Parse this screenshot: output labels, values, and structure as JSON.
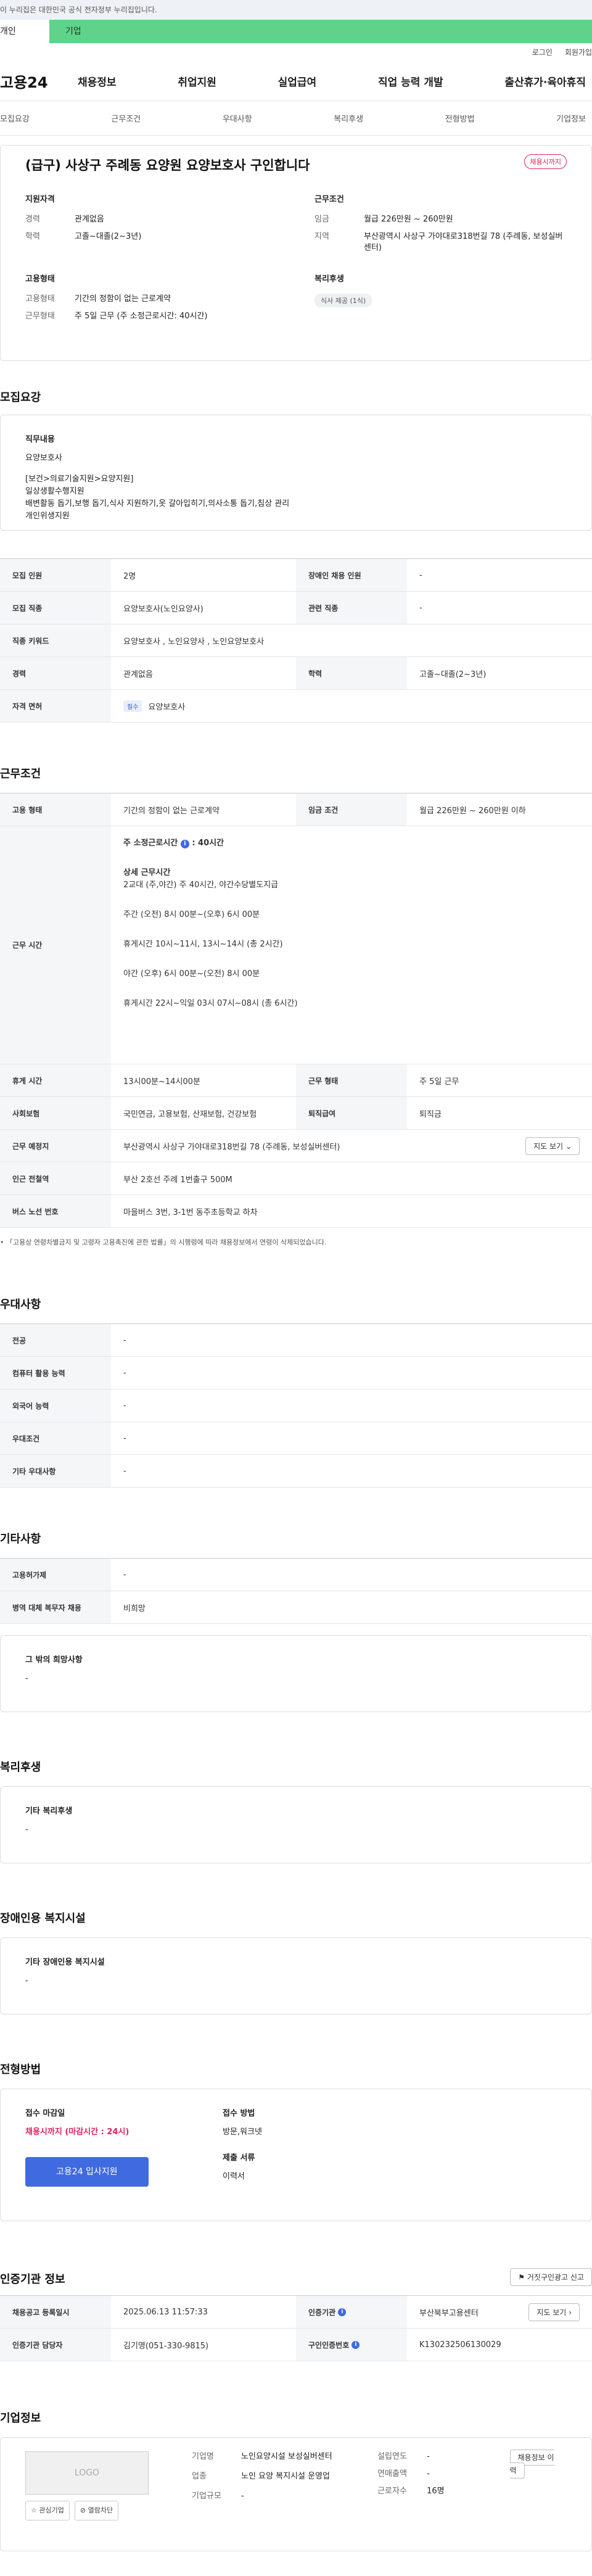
{
  "gov_banner": "이 누리집은 대한민국 공식 전자정부 누리집입니다.",
  "tabs": {
    "person": "개인",
    "company": "기업"
  },
  "util": {
    "login": "로그인",
    "signup": "회원가입"
  },
  "logo": "고용24",
  "gnb": [
    "채용정보",
    "취업지원",
    "실업급여",
    "직업 능력 개발",
    "출산휴가·육아휴직"
  ],
  "lnb": [
    "모집요강",
    "근무조건",
    "우대사항",
    "복리후생",
    "전형방법",
    "기업정보"
  ],
  "summary": {
    "title": "(급구) 사상구 주례동 요양원 요양보호사 구인합니다",
    "badge": "채용시까지",
    "qual_title": "지원자격",
    "qual": [
      {
        "k": "경력",
        "v": "관계없음"
      },
      {
        "k": "학력",
        "v": "고졸~대졸(2~3년)"
      }
    ],
    "emp_title": "고용형태",
    "emp": [
      {
        "k": "고용형태",
        "v": "기간의 정함이 없는 근로계약"
      },
      {
        "k": "근무형태",
        "v": "주 5일 근무 (주 소정근로시간: 40시간)"
      }
    ],
    "cond_title": "근무조건",
    "cond": [
      {
        "k": "임금",
        "v": "월급 226만원 ~ 260만원"
      },
      {
        "k": "지역",
        "v": "부산광역시 사상구 가야대로318번길 78 (주례동, 보성실버센터)"
      }
    ],
    "welfare_title": "복리후생",
    "welfare_chip": "식사 제공 (1식)"
  },
  "recruit": {
    "title": "모집요강",
    "job_title": "직무내용",
    "job_text": "요양보호사",
    "job_lines": [
      "[보건>의료기술지원>요양지원]",
      "일상생활수행지원",
      "배변활동 돕기,보행 돕기,식사 지원하기,옷 갈아입히기,의사소통 돕기,침상 관리",
      "개인위생지원"
    ],
    "rows": [
      {
        "k": "모집 인원",
        "v": "2명",
        "k2": "장애인 채용 인원",
        "v2": "-"
      },
      {
        "k": "모집 직종",
        "v": "요양보호사(노인요양사)",
        "k2": "관련 직종",
        "v2": "-"
      },
      {
        "k": "직종 키워드",
        "v": "요양보호사 , 노인요양사 , 노인요양보호사"
      },
      {
        "k": "경력",
        "v": "관계없음",
        "k2": "학력",
        "v2": "고졸~대졸(2~3년)"
      },
      {
        "k": "자격 면허",
        "req": "필수",
        "v": "요양보호사"
      }
    ]
  },
  "work": {
    "title": "근무조건",
    "r1": {
      "k": "고용 형태",
      "v": "기간의 정함이 없는 근로계약",
      "k2": "임금 조건",
      "v2": "월급 226만원 ~ 260만원 이하"
    },
    "time_k": "근무 시간",
    "time_week": "주 소정근로시간",
    "time_week_v": ": 40시간",
    "time_detail_title": "상세 근무시간",
    "time_lines": [
      "2교대 (주,야간) 주 40시간, 야간수당별도지급",
      "주간 (오전) 8시 00분~(오후) 6시 00분",
      "휴게시간  10시~11시, 13시~14시 (총 2시간)",
      "야간 (오후) 6시 00분~(오전) 8시 00분",
      "휴게시간  22시~익일 03시  07시~08시 (총 6시간)"
    ],
    "r3": {
      "k": "휴게 시간",
      "v": "13시00분~14시00분",
      "k2": "근무 형태",
      "v2": "주 5일 근무"
    },
    "r4": {
      "k": "사회보험",
      "v": "국민연금, 고용보험, 산재보험, 건강보험",
      "k2": "퇴직급여",
      "v2": "퇴직금"
    },
    "r5": {
      "k": "근무 예정지",
      "v": "부산광역시 사상구 가야대로318번길 78 (주례동, 보성실버센터)",
      "btn": "지도 보기"
    },
    "r6": {
      "k": "인근 전철역",
      "v": "부산 2호선 주례 1번출구 500M"
    },
    "r7": {
      "k": "버스 노선 번호",
      "v": "마을버스 3번, 3-1번 동주초등학교 하차"
    },
    "note": "「고용상 연령차별금지 및 고령자 고용촉진에 관한 법률」의 시행령에 따라 채용정보에서 연령이 삭제되었습니다."
  },
  "pref": {
    "title": "우대사항",
    "rows": [
      {
        "k": "전공",
        "v": "-"
      },
      {
        "k": "컴퓨터 활용 능력",
        "v": "-"
      },
      {
        "k": "외국어 능력",
        "v": "-"
      },
      {
        "k": "우대조건",
        "v": "-"
      },
      {
        "k": "기타 우대사항",
        "v": "-"
      }
    ]
  },
  "etc": {
    "title": "기타사항",
    "rows": [
      {
        "k": "고용허가제",
        "v": "-"
      },
      {
        "k": "병역 대체 복무자 채용",
        "v": "비희망"
      }
    ],
    "other_title": "그 밖의 희망사항",
    "other_v": "-"
  },
  "welfare": {
    "title": "복리후생",
    "sub": "기타 복리후생",
    "v": "-"
  },
  "disabled": {
    "title": "장애인용 복지시설",
    "sub": "기타 장애인용 복지시설",
    "v": "-"
  },
  "screening": {
    "title": "전형방법",
    "deadline_title": "접수 마감일",
    "deadline_v": "채용시까지 (마감시간 : 24시)",
    "apply_btn": "고용24 입사지원",
    "method_title": "접수 방법",
    "method_v": "방문,워크넷",
    "docs_title": "제출 서류",
    "docs_v": "이력서"
  },
  "cert": {
    "title": "인증기관 정보",
    "report_btn": "거짓구인광고 신고",
    "rows": [
      {
        "k": "채용공고 등록일시",
        "v": "2025.06.13 11:57:33",
        "k2": "인증기관",
        "v2": "부산북부고용센터",
        "btn": "지도 보기"
      },
      {
        "k": "인증기관 담당자",
        "v": "김기영(051-330-9815)",
        "k2": "구인인증번호",
        "v2": "K130232506130029"
      }
    ]
  },
  "company": {
    "title": "기업정보",
    "logo": "LOGO",
    "fav_btn": "관심기업",
    "block_btn": "열람차단",
    "name_k": "기업명",
    "name_v": "노인요양시설 보성실버센터",
    "ind_k": "업종",
    "ind_v": "노인 요양 복지시설 운영업",
    "size_k": "기업규모",
    "size_v": "-",
    "year_k": "설립연도",
    "year_v": "-",
    "sales_k": "연매출액",
    "sales_v": "-",
    "emp_k": "근로자수",
    "emp_v": "16명",
    "history_btn": "채용정보 이력"
  }
}
